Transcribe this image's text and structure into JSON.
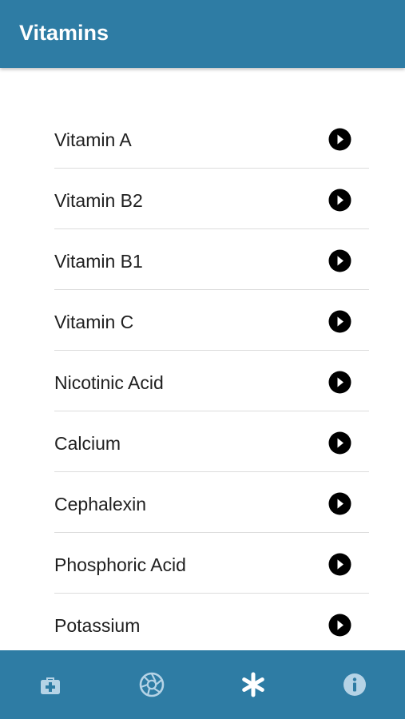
{
  "header": {
    "title": "Vitamins"
  },
  "list": {
    "items": [
      {
        "label": "Vitamin A"
      },
      {
        "label": "Vitamin B2"
      },
      {
        "label": "Vitamin B1"
      },
      {
        "label": "Vitamin C"
      },
      {
        "label": "Nicotinic Acid"
      },
      {
        "label": "Calcium"
      },
      {
        "label": "Cephalexin"
      },
      {
        "label": "Phosphoric Acid"
      },
      {
        "label": "Potassium"
      }
    ],
    "arrow_icon": "chevron-circle-right-icon"
  },
  "bottom_nav": {
    "items": [
      {
        "icon": "first-aid-kit-icon",
        "active": false
      },
      {
        "icon": "aperture-icon",
        "active": false
      },
      {
        "icon": "asterisk-icon",
        "active": true
      },
      {
        "icon": "info-icon",
        "active": false
      }
    ]
  },
  "colors": {
    "primary": "#2e7ca4",
    "icon_inactive": "#b5d3e6",
    "icon_active": "#ffffff",
    "text": "#202020",
    "divider": "#dcdcdc"
  }
}
